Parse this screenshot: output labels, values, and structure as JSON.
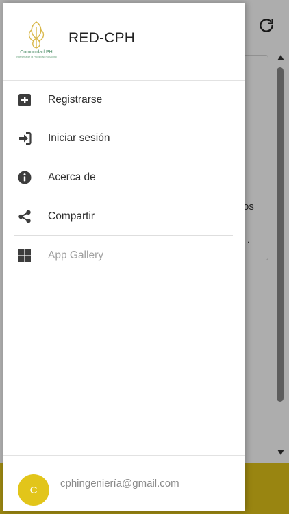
{
  "drawer": {
    "title": "RED-CPH",
    "logo_text": {
      "line1": "Comunidad PH",
      "line2": "Ingeniería de la Propiedad Horizontal"
    },
    "menu": [
      {
        "label": "Registrarse",
        "icon": "plus-square-icon",
        "enabled": true
      },
      {
        "label": "Iniciar sesión",
        "icon": "sign-in-icon",
        "enabled": true
      },
      {
        "label": "Acerca de",
        "icon": "info-circle-icon",
        "enabled": true
      },
      {
        "label": "Compartir",
        "icon": "share-icon",
        "enabled": true
      },
      {
        "label": "App Gallery",
        "icon": "grid-icon",
        "enabled": false
      }
    ],
    "user": {
      "avatar_initial": "C",
      "email": "cphingeniería@gmail.com"
    }
  },
  "background": {
    "card_fragment": "os",
    "card_dot": ".",
    "refresh_icon": "refresh-icon"
  },
  "colors": {
    "accent": "#e2c51a",
    "footer_bg": "#e2c51a",
    "icon": "#3d3d3d",
    "dim": "#a0a0a0"
  }
}
